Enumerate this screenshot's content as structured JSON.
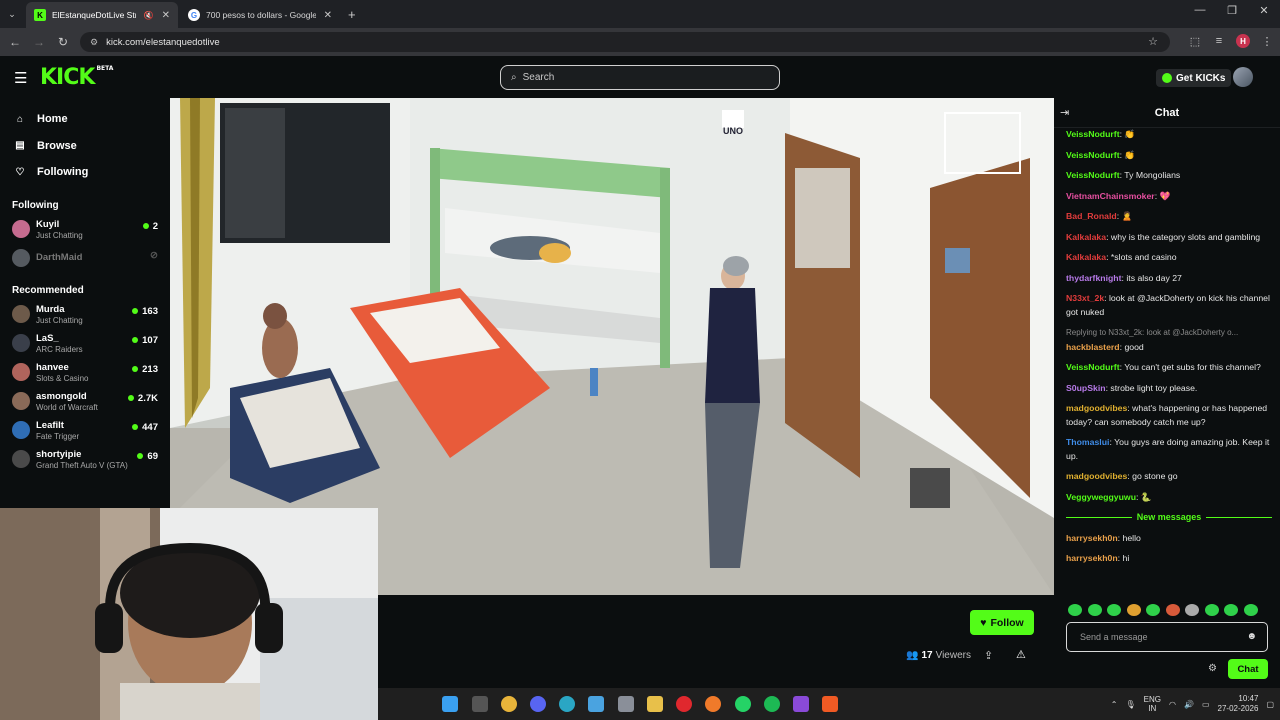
{
  "browser": {
    "tabs": [
      {
        "title": "ElEstanqueDotLive Stream",
        "active": true,
        "favicon": "kick-favicon"
      },
      {
        "title": "700 pesos to dollars - Google S",
        "active": false,
        "favicon": "google-favicon"
      }
    ],
    "url": "kick.com/elestanquedotlive",
    "profile_initial": "H"
  },
  "header": {
    "logo": "KICK",
    "logo_badge": "BETA",
    "search_placeholder": "Search",
    "get_kicks": "Get KICKs"
  },
  "sidebar": {
    "nav": [
      {
        "label": "Home",
        "icon": "home-icon"
      },
      {
        "label": "Browse",
        "icon": "browse-icon"
      },
      {
        "label": "Following",
        "icon": "heart-icon"
      }
    ],
    "following_title": "Following",
    "following": [
      {
        "name": "Kuyil",
        "category": "Just Chatting",
        "viewers": "2",
        "live": true,
        "color": "#c56b8f"
      },
      {
        "name": "DarthMaid",
        "category": "",
        "viewers": "",
        "live": false,
        "color": "#555a60"
      }
    ],
    "recommended_title": "Recommended",
    "recommended": [
      {
        "name": "Murda",
        "category": "Just Chatting",
        "viewers": "163",
        "color": "#6d5a4a"
      },
      {
        "name": "LaS_",
        "category": "ARC Raiders",
        "viewers": "107",
        "color": "#3a3f4a"
      },
      {
        "name": "hanvee",
        "category": "Slots & Casino",
        "viewers": "213",
        "color": "#b0645c"
      },
      {
        "name": "asmongold",
        "category": "World of Warcraft",
        "viewers": "2.7K",
        "color": "#8a6a58"
      },
      {
        "name": "Leafilt",
        "category": "Fate Trigger",
        "viewers": "447",
        "color": "#2f6db5"
      },
      {
        "name": "shortyipie",
        "category": "Grand Theft Auto V (GTA)",
        "viewers": "69",
        "color": "#4a4a4a"
      }
    ]
  },
  "stream": {
    "follow_label": "Follow",
    "viewers_count": "17",
    "viewers_label": "Viewers",
    "sign_text": "UNO"
  },
  "chat": {
    "title": "Chat",
    "messages": [
      {
        "user": "VeissNodurft",
        "color": "#53fc18",
        "text": "",
        "emote": "👏"
      },
      {
        "user": "VeissNodurft",
        "color": "#53fc18",
        "text": "",
        "emote": "👏"
      },
      {
        "user": "VeissNodurft",
        "color": "#53fc18",
        "text": "Ty Mongolians",
        "emote": ""
      },
      {
        "user": "VietnamChainsmoker",
        "color": "#e64fa0",
        "text": "",
        "emote": "💖"
      },
      {
        "user": "Bad_Ronald",
        "color": "#e23c3c",
        "text": "",
        "emote": "🙎"
      },
      {
        "user": "Kalkalaka",
        "color": "#e23c3c",
        "text": "why is the category slots and gambling",
        "emote": ""
      },
      {
        "user": "Kalkalaka",
        "color": "#e23c3c",
        "text": "*slots and casino",
        "emote": ""
      },
      {
        "user": "thydarfknight",
        "color": "#b77ae8",
        "text": "its also day 27",
        "emote": ""
      },
      {
        "user": "N33xt_2k",
        "color": "#e23c3c",
        "text": "look at @JackDoherty on kick his channel got nuked",
        "emote": ""
      },
      {
        "user": "hackblasterd",
        "color": "#e8a04a",
        "text": "good",
        "emote": "",
        "reply": "Replying to N33xt_2k: look at @JackDoherty o..."
      },
      {
        "user": "VeissNodurft",
        "color": "#53fc18",
        "text": "You can't get subs for this channel?",
        "emote": ""
      },
      {
        "user": "S0upSkin",
        "color": "#b77ae8",
        "text": "strobe light toy please.",
        "emote": ""
      },
      {
        "user": "madgoodvibes",
        "color": "#e0b030",
        "text": "what's happening or has happened today? can somebody catch me up?",
        "emote": ""
      },
      {
        "user": "Thomaslui",
        "color": "#3f8ce8",
        "text": "You guys are doing amazing job. Keep it up.",
        "emote": ""
      },
      {
        "user": "madgoodvibes",
        "color": "#e0b030",
        "text": "go stone go",
        "emote": ""
      },
      {
        "user": "Veggyweggyuwu",
        "color": "#53fc18",
        "text": "",
        "emote": "🐍"
      }
    ],
    "new_messages_label": "New messages",
    "new_messages": [
      {
        "user": "harrysekh0n",
        "color": "#e8a04a",
        "text": "hello"
      },
      {
        "user": "harrysekh0n",
        "color": "#e8a04a",
        "text": "hi"
      }
    ],
    "input_placeholder": "Send a message",
    "send_label": "Chat"
  },
  "taskbar": {
    "lang": "ENG",
    "region": "IN",
    "time": "10:47",
    "date": "27-02-2026"
  }
}
